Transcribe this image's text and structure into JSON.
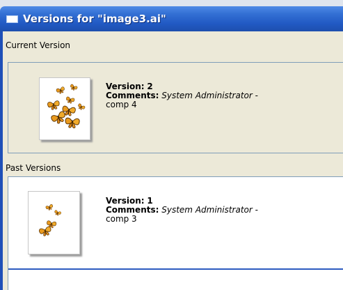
{
  "window": {
    "title": "Versions for \"image3.ai\""
  },
  "current": {
    "section_label": "Current Version",
    "version_label": "Version:",
    "version_number": "2",
    "comments_label": "Comments:",
    "author": "System Administrator",
    "separator": "-",
    "comment": "comp 4",
    "thumbnail_icon": "butterflies-image-thumbnail"
  },
  "past": {
    "section_label": "Past Versions",
    "items": [
      {
        "version_label": "Version:",
        "version_number": "1",
        "comments_label": "Comments:",
        "author": "System Administrator",
        "separator": "-",
        "comment": "comp 3",
        "thumbnail_icon": "butterflies-image-thumbnail"
      }
    ]
  },
  "colors": {
    "titlebar": "#2159c3",
    "client": "#ece9d8",
    "box_border": "#7f9db9",
    "butterfly": "#e79a1f"
  }
}
